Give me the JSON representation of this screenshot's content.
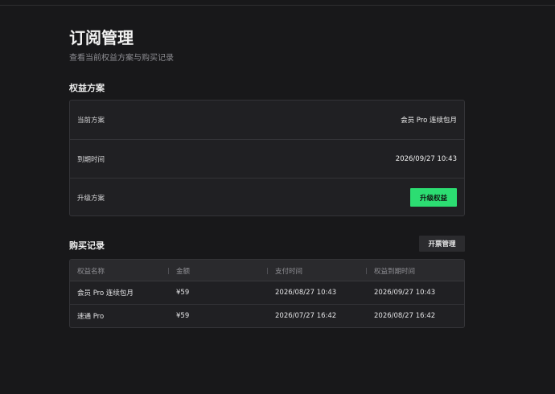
{
  "header": {
    "title": "订阅管理",
    "subtitle": "查看当前权益方案与购买记录"
  },
  "plan_section": {
    "title": "权益方案",
    "rows": [
      {
        "label": "当前方案",
        "value": "会员 Pro 连续包月"
      },
      {
        "label": "到期时间",
        "value": "2026/09/27 10:43"
      },
      {
        "label": "升级方案",
        "button": "升级权益"
      }
    ]
  },
  "purchase_section": {
    "title": "购买记录",
    "invoice_button": "开票管理",
    "columns": [
      "权益名称",
      "金额",
      "支付时间",
      "权益到期时间"
    ],
    "rows": [
      [
        "会员 Pro 连续包月",
        "¥59",
        "2026/08/27 10:43",
        "2026/09/27 10:43"
      ],
      [
        "速通 Pro",
        "¥59",
        "2026/07/27 16:42",
        "2026/08/27 16:42"
      ]
    ]
  },
  "colors": {
    "background": "#18181a",
    "card": "#202023",
    "accent": "#2cdd72"
  }
}
